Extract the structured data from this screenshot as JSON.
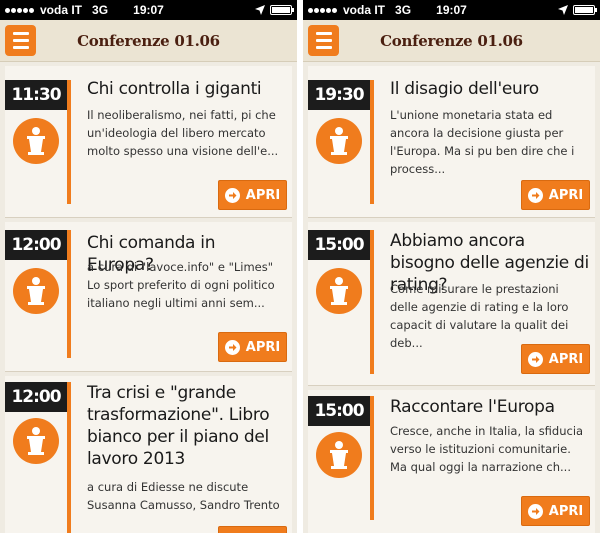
{
  "status_bar": {
    "carrier": "voda IT",
    "network": "3G",
    "time": "19:07"
  },
  "navbar": {
    "title": "Conferenze 01.06",
    "menu_icon": "hamburger-menu-icon"
  },
  "colors": {
    "accent": "#f07c1d",
    "badge": "#1c1c1c",
    "background": "#efebe2",
    "title": "#4a1f10"
  },
  "apri_label": "APRI",
  "left_column": [
    {
      "time": "11:30",
      "title": "Chi controlla i giganti",
      "desc": "Il neoliberalismo, nei fatti, pi che un'ideologia del libero mercato molto spesso una visione dell'e..."
    },
    {
      "time": "12:00",
      "title": "Chi comanda in Europa?",
      "desc": "a cura di \"lavoce.info\" e \"Limes\" Lo sport preferito di ogni politico italiano negli ultimi anni sem..."
    },
    {
      "time": "12:00",
      "title": "Tra crisi e \"grande trasformazione\". Libro bianco per il piano del lavoro 2013",
      "desc": "a cura di Ediesse ne discute Susanna Camusso, Sandro Trento"
    }
  ],
  "right_column": [
    {
      "time": "19:30",
      "title": "Il disagio dell'euro",
      "desc": "L'unione monetaria stata ed ancora la decisione giusta per l'Europa. Ma si pu ben dire che i process..."
    },
    {
      "time": "15:00",
      "title": "Abbiamo ancora bisogno delle agenzie di rating?",
      "desc": "Come misurare le prestazioni delle agenzie di rating e la loro capacit di valutare la qualit dei deb..."
    },
    {
      "time": "15:00",
      "title": "Raccontare l'Europa",
      "desc": "Cresce, anche in Italia, la sfiducia verso le istituzioni comunitarie. Ma qual oggi la narrazione ch..."
    }
  ]
}
